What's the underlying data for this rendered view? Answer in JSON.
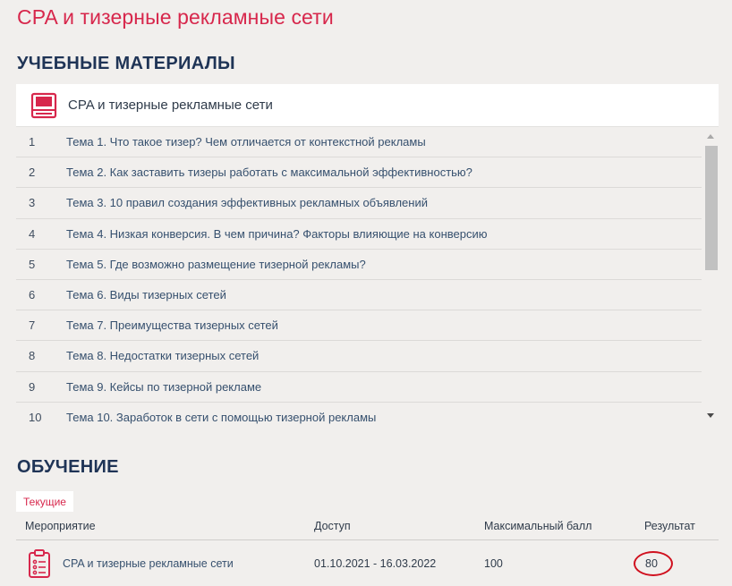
{
  "page": {
    "title": "CPA и тизерные рекламные сети"
  },
  "materials": {
    "section_title": "УЧЕБНЫЕ МАТЕРИАЛЫ",
    "course_title": "CPA и тизерные рекламные сети",
    "course_icon": "book-icon",
    "topics": [
      {
        "num": "1",
        "title": "Тема 1. Что такое тизер? Чем отличается от контекстной рекламы"
      },
      {
        "num": "2",
        "title": "Тема 2. Как заставить тизеры работать с максимальной эффективностью?"
      },
      {
        "num": "3",
        "title": "Тема 3. 10 правил создания эффективных рекламных объявлений"
      },
      {
        "num": "4",
        "title": "Тема 4. Низкая конверсия. В чем причина? Факторы влияющие на конверсию"
      },
      {
        "num": "5",
        "title": "Тема 5. Где возможно размещение тизерной рекламы?"
      },
      {
        "num": "6",
        "title": "Тема 6. Виды тизерных сетей"
      },
      {
        "num": "7",
        "title": "Тема 7. Преимущества тизерных сетей"
      },
      {
        "num": "8",
        "title": "Тема 8. Недостатки тизерных сетей"
      },
      {
        "num": "9",
        "title": "Тема 9. Кейсы по тизерной рекламе"
      },
      {
        "num": "10",
        "title": "Тема 10. Заработок в сети с помощью тизерной рекламы"
      }
    ]
  },
  "training": {
    "section_title": "ОБУЧЕНИЕ",
    "tab_current": "Текущие",
    "columns": {
      "event": "Мероприятие",
      "access": "Доступ",
      "max_score": "Максимальный балл",
      "result": "Результат"
    },
    "row": {
      "title": "CPA и тизерные рекламные сети",
      "access": "01.10.2021 - 16.03.2022",
      "max_score": "100",
      "result": "80",
      "icon": "clipboard-list-icon"
    }
  },
  "colors": {
    "accent": "#d7274c",
    "heading": "#1f3456",
    "background": "#f1efed",
    "highlight_ring": "#d0101e"
  }
}
